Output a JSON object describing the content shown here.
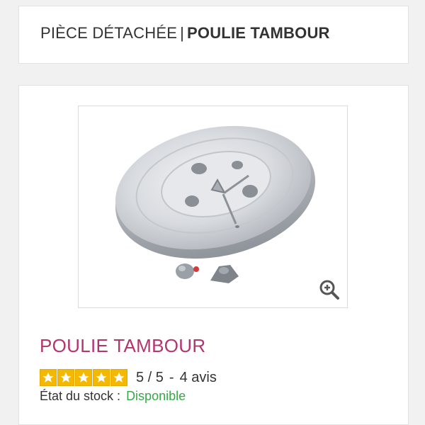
{
  "header": {
    "title_prefix": "PIÈCE DÉTACHÉE",
    "separator": "|",
    "title_product": "POULIE TAMBOUR"
  },
  "product": {
    "name": "POULIE TAMBOUR",
    "image_alt": "Poulie tambour",
    "zoom_icon": "zoom-in-icon",
    "rating": {
      "stars": 5,
      "max": 5,
      "score": "5 / 5",
      "dash": "-",
      "reviews": "4 avis",
      "star_color": "#f5b800"
    },
    "stock": {
      "label": "État du stock :",
      "value": "Disponible",
      "value_color": "#3aa64a"
    }
  },
  "colors": {
    "accent": "#b3356e"
  }
}
